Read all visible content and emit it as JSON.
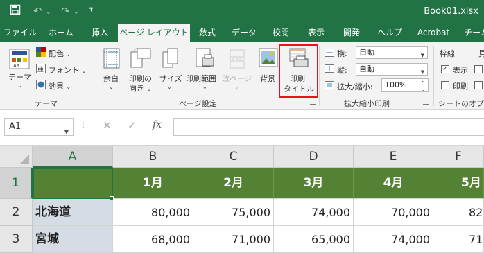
{
  "title_bar": {
    "doc_title": "Book01.xlsx",
    "save_icon": "save-icon",
    "undo_icon": "undo-icon",
    "redo_icon": "redo-icon",
    "customize_icon": "customize-qat-icon"
  },
  "tabs": [
    {
      "label": "ファイル"
    },
    {
      "label": "ホーム"
    },
    {
      "label": "挿入"
    },
    {
      "label": "ページ レイアウト",
      "active": true
    },
    {
      "label": "数式"
    },
    {
      "label": "データ"
    },
    {
      "label": "校閲"
    },
    {
      "label": "表示"
    },
    {
      "label": "開発"
    },
    {
      "label": "ヘルプ"
    },
    {
      "label": "Acrobat"
    },
    {
      "label": "チーム"
    }
  ],
  "ribbon": {
    "theme_group": {
      "title": "テーマ",
      "theme_button": "テーマ",
      "colors": "配色",
      "fonts": "フォント",
      "effects": "効果"
    },
    "page_setup_group": {
      "title": "ページ設定",
      "margins_l1": "余白",
      "orientation_l1": "印刷の",
      "orientation_l2": "向き",
      "size_l1": "サイズ",
      "print_area_l1": "印刷範囲",
      "breaks_l1": "改ページ",
      "background_l1": "背景",
      "print_titles_l1": "印刷",
      "print_titles_l2": "タイトル"
    },
    "scale_group": {
      "title": "拡大縮小印刷",
      "width_label": "横:",
      "width_value": "自動",
      "height_label": "縦:",
      "height_value": "自動",
      "scale_label": "拡大/縮小:",
      "scale_value": "100%"
    },
    "sheet_options_group": {
      "title": "シートのオプション",
      "gridlines_title": "枠線",
      "view_label": "表示",
      "view_checked": true,
      "print_label": "印刷",
      "print_checked": false,
      "headings_title": "見"
    }
  },
  "formula_bar": {
    "name_box": "A1",
    "cancel_icon": "✕",
    "enter_icon": "✓",
    "fx_label": "fx",
    "formula_value": ""
  },
  "sheet": {
    "columns": [
      "A",
      "B",
      "C",
      "D",
      "E",
      "F"
    ],
    "rows": [
      "1",
      "2",
      "3"
    ],
    "header_row": [
      "",
      "1月",
      "2月",
      "3月",
      "4月",
      "5月"
    ],
    "data_rows": [
      {
        "name": "北海道",
        "values": [
          "80,000",
          "75,000",
          "74,000",
          "70,000",
          "82"
        ]
      },
      {
        "name": "宮城",
        "values": [
          "68,000",
          "71,000",
          "65,000",
          "74,000",
          "71"
        ]
      }
    ],
    "selected_cell": "A1",
    "header_fill": "#548235",
    "name_fill": "#d6dce4"
  },
  "colors": {
    "accent": "#217346",
    "highlight": "#e8141c"
  }
}
